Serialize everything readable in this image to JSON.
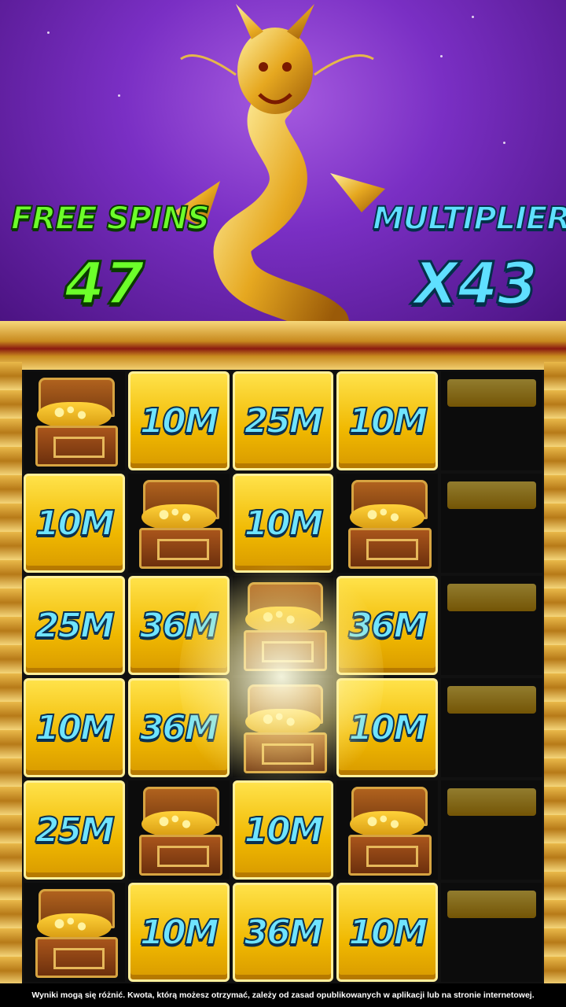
{
  "hud": {
    "free_spins_label": "FREE SPINS",
    "free_spins_value": "47",
    "multiplier_label": "MULTIPLIER",
    "multiplier_value": "X43"
  },
  "grid": {
    "rows": [
      [
        "chest",
        "10M",
        "25M",
        "10M",
        "dark"
      ],
      [
        "10M",
        "chest",
        "10M",
        "chest",
        "dark"
      ],
      [
        "25M",
        "36M",
        "chest",
        "36M",
        "dark"
      ],
      [
        "10M",
        "36M",
        "chest",
        "10M",
        "dark"
      ],
      [
        "25M",
        "chest",
        "10M",
        "chest",
        "dark"
      ],
      [
        "chest",
        "10M",
        "36M",
        "10M",
        "dark"
      ]
    ]
  },
  "footer": {
    "disclaimer": "Wyniki mogą się różnić. Kwota, którą możesz otrzymać, zależy od zasad opublikowanych w aplikacji lub na stronie internetowej."
  },
  "colors": {
    "free_spins": "#6cff2a",
    "multiplier": "#5fe0ff",
    "tile_gold": "#f0b800",
    "sky": "#7a2fc4"
  }
}
